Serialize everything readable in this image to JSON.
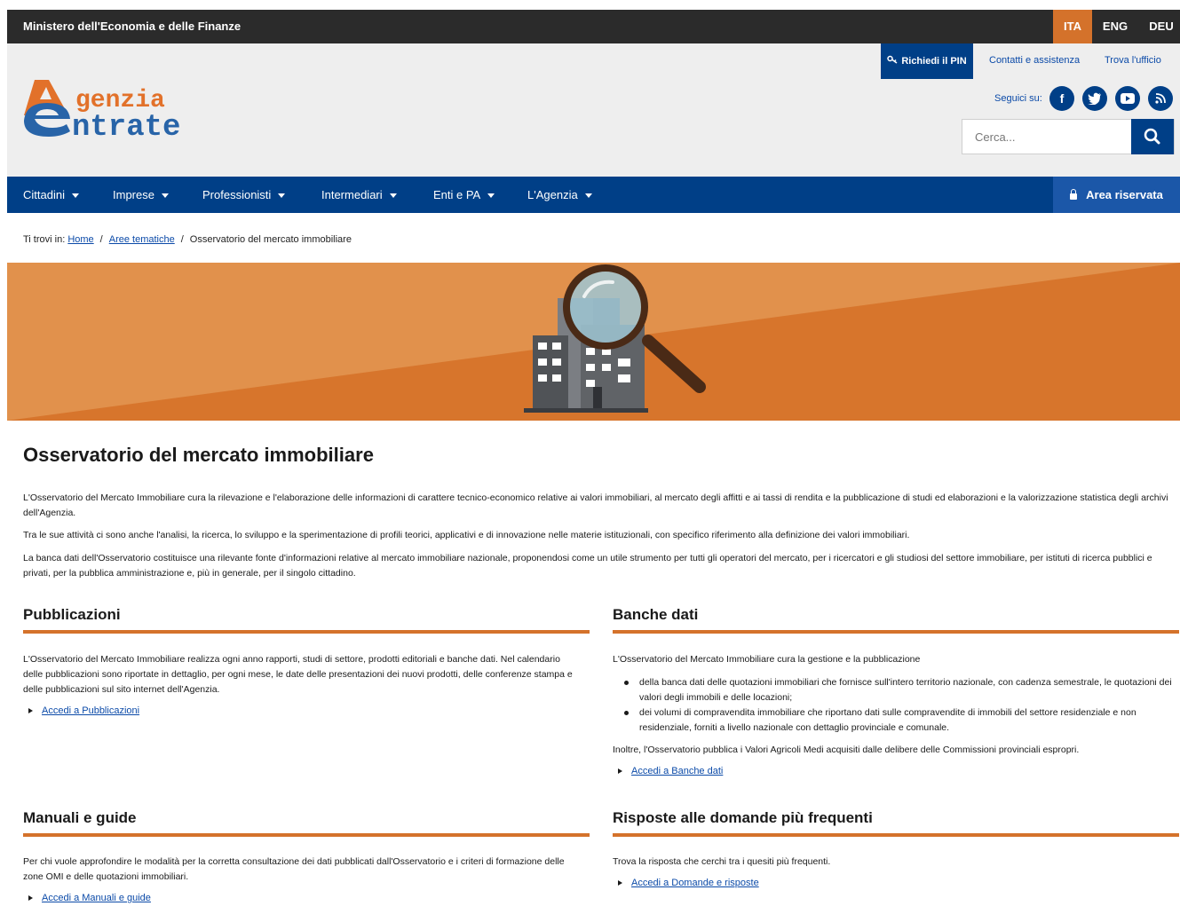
{
  "topbar": {
    "ministry": "Ministero dell'Economia e delle Finanze",
    "languages": [
      {
        "code": "ITA",
        "active": true
      },
      {
        "code": "ENG",
        "active": false
      },
      {
        "code": "DEU",
        "active": false
      }
    ]
  },
  "header": {
    "logo_line1": "genzia",
    "logo_line2": "ntrate",
    "pin_button": "Richiedi il PIN",
    "links": [
      "Contatti e assistenza",
      "Trova l'ufficio"
    ],
    "follow_label": "Seguici su:",
    "social": [
      "facebook-icon",
      "twitter-icon",
      "youtube-icon",
      "rss-icon"
    ],
    "search_placeholder": "Cerca..."
  },
  "nav": {
    "items": [
      "Cittadini",
      "Imprese",
      "Professionisti",
      "Intermediari",
      "Enti e PA",
      "L'Agenzia"
    ],
    "area_button": "Area riservata"
  },
  "breadcrumb": {
    "prefix": "Ti trovi in:",
    "items": [
      "Home",
      "Aree tematiche"
    ],
    "current": "Osservatorio del mercato immobiliare"
  },
  "main": {
    "title": "Osservatorio del mercato immobiliare",
    "paragraphs": [
      "L'Osservatorio del Mercato Immobiliare cura la rilevazione e l'elaborazione delle informazioni di carattere tecnico-economico relative ai valori immobiliari, al mercato degli affitti e ai tassi di rendita e la pubblicazione di studi ed elaborazioni e la valorizzazione statistica degli archivi dell'Agenzia.",
      "Tra le sue attività ci sono anche l'analisi, la ricerca, lo sviluppo e la sperimentazione di profili teorici, applicativi e di innovazione nelle materie istituzionali, con specifico riferimento alla definizione dei valori immobiliari.",
      "La banca dati dell'Osservatorio costituisce una rilevante fonte d'informazioni relative al mercato immobiliare nazionale, proponendosi come un utile strumento per tutti gli operatori del mercato, per i ricercatori e gli studiosi del settore immobiliare, per istituti di ricerca pubblici e privati, per la pubblica amministrazione e, più in generale, per il singolo cittadino."
    ],
    "sections": {
      "pubblicazioni": {
        "title": "Pubblicazioni",
        "text": "L'Osservatorio del Mercato Immobiliare realizza ogni anno rapporti, studi di settore, prodotti editoriali e banche dati. Nel calendario delle pubblicazioni sono riportate in dettaglio, per ogni mese, le date delle presentazioni dei nuovi prodotti, delle conferenze stampa e delle pubblicazioni sul sito internet dell'Agenzia.",
        "link": "Accedi a Pubblicazioni"
      },
      "banche": {
        "title": "Banche dati",
        "text": "L'Osservatorio del Mercato Immobiliare cura la gestione e la pubblicazione",
        "bullets": [
          "della banca dati delle quotazioni immobiliari che fornisce sull'intero territorio nazionale, con cadenza semestrale, le quotazioni dei valori degli immobili e delle locazioni;",
          "dei volumi di compravendita immobiliare che riportano dati sulle compravendite di immobili del settore residenziale e non residenziale, forniti a livello nazionale con dettaglio provinciale e comunale."
        ],
        "extra": "Inoltre, l'Osservatorio pubblica i Valori Agricoli Medi acquisiti dalle delibere delle Commissioni provinciali espropri.",
        "link": "Accedi a Banche dati"
      },
      "manuali": {
        "title": "Manuali e guide",
        "text": "Per chi vuole approfondire le modalità per la corretta consultazione dei dati pubblicati dall'Osservatorio e i criteri di formazione delle zone OMI e delle quotazioni immobiliari.",
        "link": "Accedi a Manuali e guide"
      },
      "faq": {
        "title": "Risposte alle domande più frequenti",
        "text": "Trova la risposta che cerchi tra i quesiti più frequenti.",
        "link": "Accedi a Domande e risposte"
      }
    }
  },
  "colors": {
    "dark_bar": "#2b2b2b",
    "brand_blue": "#003f87",
    "accent_orange": "#d4722b",
    "header_bg": "#eeeeee"
  }
}
